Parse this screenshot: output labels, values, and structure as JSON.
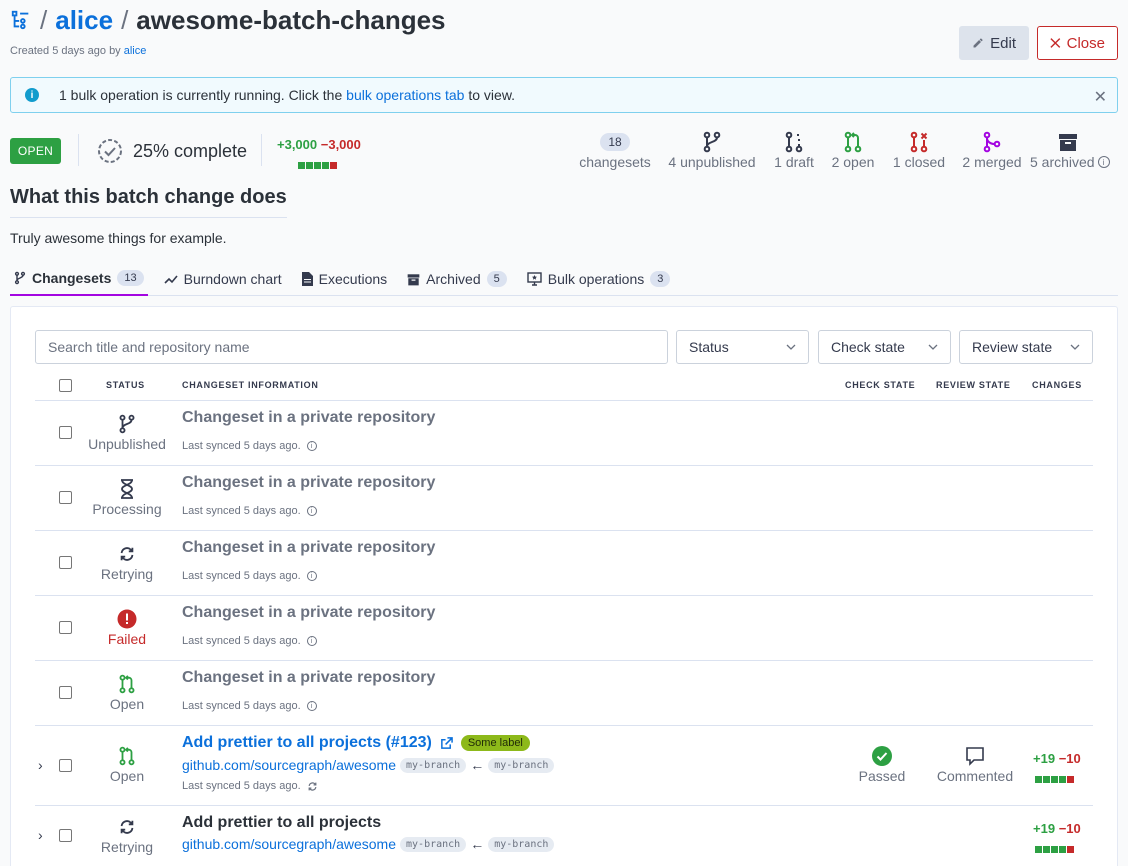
{
  "header": {
    "namespace": "alice",
    "title": "awesome-batch-changes",
    "created_prefix": "Created 5 days ago by",
    "created_by": "alice",
    "edit_label": "Edit",
    "close_label": "Close"
  },
  "alert": {
    "text_before": "1 bulk operation is currently running. Click the",
    "link_text": "bulk operations tab",
    "text_after": "to view."
  },
  "summary": {
    "state": "OPEN",
    "complete_text": "25% complete",
    "added": "+3,000",
    "removed": "−3,000",
    "stats": [
      {
        "count": "18",
        "label": "changesets"
      },
      {
        "label": "4 unpublished"
      },
      {
        "label": "1 draft"
      },
      {
        "label": "2 open"
      },
      {
        "label": "1 closed"
      },
      {
        "label": "2 merged"
      },
      {
        "label": "5 archived"
      }
    ]
  },
  "description": {
    "heading": "What this batch change does",
    "body": "Truly awesome things for example."
  },
  "tabs": [
    {
      "label": "Changesets",
      "count": "13"
    },
    {
      "label": "Burndown chart"
    },
    {
      "label": "Executions"
    },
    {
      "label": "Archived",
      "count": "5"
    },
    {
      "label": "Bulk operations",
      "count": "3"
    }
  ],
  "filters": {
    "search_placeholder": "Search title and repository name",
    "status": "Status",
    "check_state": "Check state",
    "review_state": "Review state"
  },
  "table": {
    "headers": {
      "status": "STATUS",
      "info": "CHANGESET INFORMATION",
      "check": "CHECK STATE",
      "review": "REVIEW STATE",
      "changes": "CHANGES"
    },
    "rows": [
      {
        "status": "Unpublished",
        "title": "Changeset in a private repository",
        "sync": "Last synced 5 days ago."
      },
      {
        "status": "Processing",
        "title": "Changeset in a private repository",
        "sync": "Last synced 5 days ago."
      },
      {
        "status": "Retrying",
        "title": "Changeset in a private repository",
        "sync": "Last synced 5 days ago."
      },
      {
        "status": "Failed",
        "title": "Changeset in a private repository",
        "sync": "Last synced 5 days ago."
      },
      {
        "status": "Open",
        "title": "Changeset in a private repository",
        "sync": "Last synced 5 days ago."
      },
      {
        "status": "Open",
        "title": "Add prettier to all projects (#123)",
        "label": "Some label",
        "repo": "github.com/sourcegraph/awesome",
        "head": "my-branch",
        "base": "my-branch",
        "sync": "Last synced 5 days ago.",
        "check": "Passed",
        "review": "Commented",
        "added": "+19",
        "removed": "−10"
      },
      {
        "status": "Retrying",
        "title": "Add prettier to all projects",
        "repo": "github.com/sourcegraph/awesome",
        "head": "my-branch",
        "base": "my-branch",
        "added": "+19",
        "removed": "−10"
      }
    ]
  },
  "colors": {
    "brand": "#0b70db",
    "open": "#2da043",
    "closed": "#c52a2a",
    "merged": "#a305e1"
  }
}
